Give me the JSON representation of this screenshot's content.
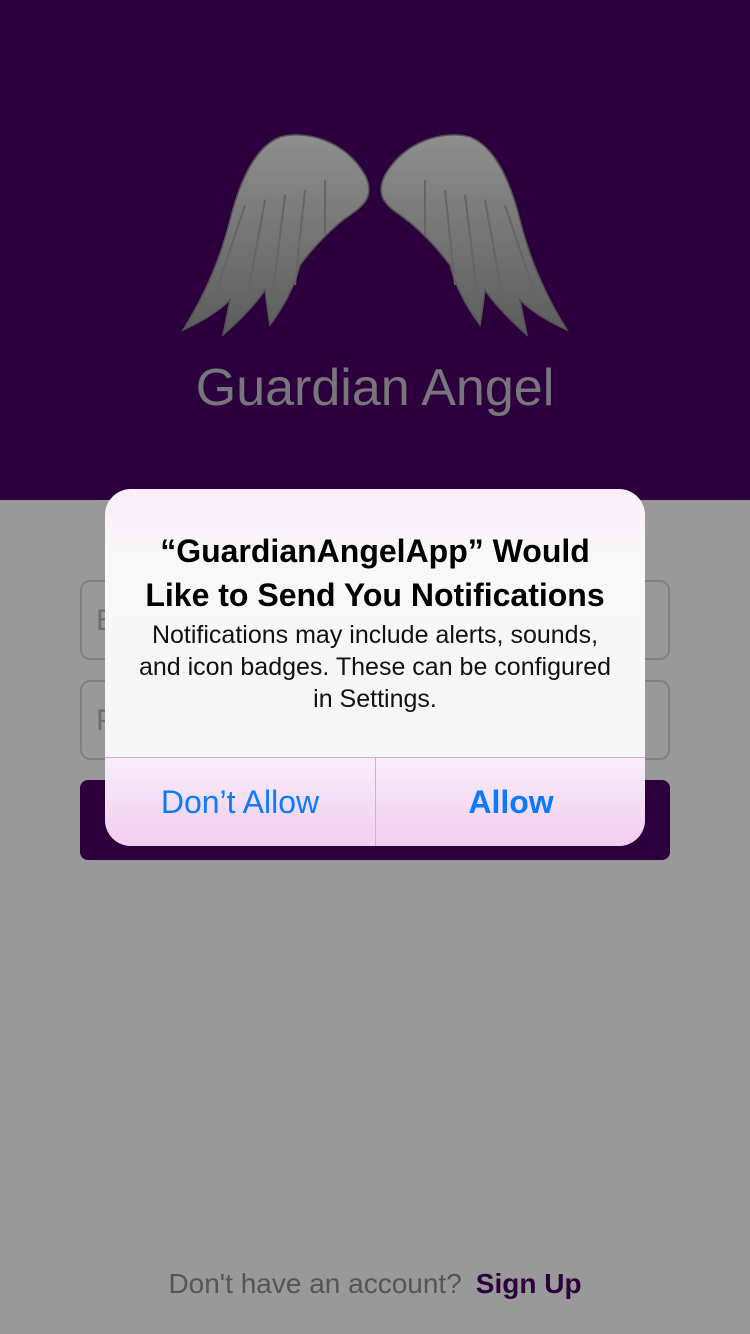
{
  "header": {
    "logo_icon": "angel-wings-icon",
    "app_name": "Guardian Angel",
    "background_color": "#4a0066"
  },
  "form": {
    "email_placeholder": "E",
    "password_placeholder": "P"
  },
  "footer": {
    "question": "Don't have an account?",
    "signup_label": "Sign Up"
  },
  "alert": {
    "title": "“GuardianAngelApp” Would Like to Send You Notifications",
    "message": "Notifications may include alerts, sounds, and icon badges. These can be configured in Settings.",
    "deny_label": "Don’t Allow",
    "allow_label": "Allow",
    "button_color": "#0a7aff"
  }
}
